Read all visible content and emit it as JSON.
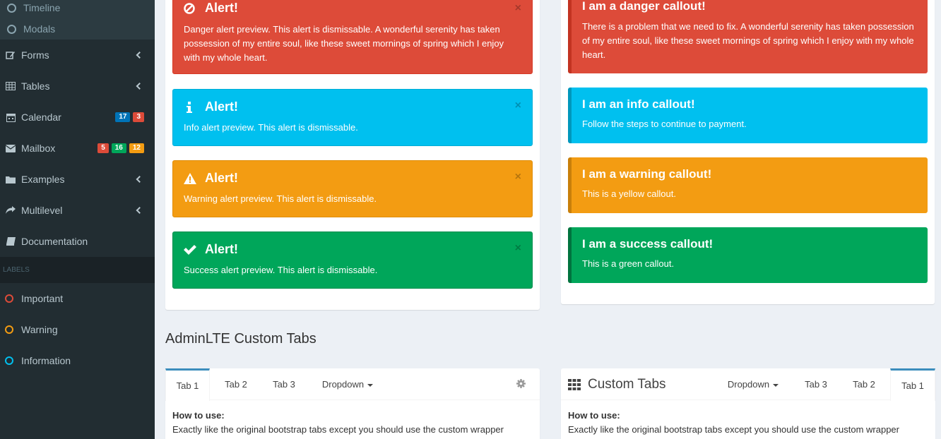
{
  "sidebar": {
    "sub_items": [
      {
        "label": "Timeline"
      },
      {
        "label": "Modals"
      }
    ],
    "items": [
      {
        "label": "Forms",
        "icon": "edit-icon"
      },
      {
        "label": "Tables",
        "icon": "table-icon"
      },
      {
        "label": "Calendar",
        "icon": "calendar-icon",
        "badges": [
          {
            "text": "17",
            "color": "#0073b7"
          },
          {
            "text": "3",
            "color": "#dd4b39"
          }
        ]
      },
      {
        "label": "Mailbox",
        "icon": "envelope-icon",
        "badges": [
          {
            "text": "5",
            "color": "#dd4b39"
          },
          {
            "text": "16",
            "color": "#00a65a"
          },
          {
            "text": "12",
            "color": "#f39c12"
          }
        ]
      },
      {
        "label": "Examples",
        "icon": "folder-icon"
      },
      {
        "label": "Multilevel",
        "icon": "share-icon"
      },
      {
        "label": "Documentation",
        "icon": "book-icon"
      }
    ],
    "labels_header": "LABELS",
    "labels": [
      {
        "label": "Important",
        "color": "#dd4b39"
      },
      {
        "label": "Warning",
        "color": "#f39c12"
      },
      {
        "label": "Information",
        "color": "#00c0ef"
      }
    ]
  },
  "alerts": [
    {
      "title": "Alert!",
      "text": "Danger alert preview. This alert is dismissable. A wonderful serenity has taken possession of my entire soul, like these sweet mornings of spring which I enjoy with my whole heart.",
      "color": "#dd4b39",
      "icon": "ban-icon"
    },
    {
      "title": "Alert!",
      "text": "Info alert preview. This alert is dismissable.",
      "color": "#00c0ef",
      "icon": "info-icon"
    },
    {
      "title": "Alert!",
      "text": "Warning alert preview. This alert is dismissable.",
      "color": "#f39c12",
      "icon": "warning-icon"
    },
    {
      "title": "Alert!",
      "text": "Success alert preview. This alert is dismissable.",
      "color": "#00a65a",
      "icon": "check-icon"
    }
  ],
  "close_glyph": "×",
  "callouts": [
    {
      "title": "I am a danger callout!",
      "text": "There is a problem that we need to fix. A wonderful serenity has taken possession of my entire soul, like these sweet mornings of spring which I enjoy with my whole heart.",
      "color": "#dd4b39",
      "border": "#c23321"
    },
    {
      "title": "I am an info callout!",
      "text": "Follow the steps to continue to payment.",
      "color": "#00c0ef",
      "border": "#0097bc"
    },
    {
      "title": "I am a warning callout!",
      "text": "This is a yellow callout.",
      "color": "#f39c12",
      "border": "#c87f0a"
    },
    {
      "title": "I am a success callout!",
      "text": "This is a green callout.",
      "color": "#00a65a",
      "border": "#00733e"
    }
  ],
  "section_title": "AdminLTE Custom Tabs",
  "tabs_left": {
    "tabs": [
      "Tab 1",
      "Tab 2",
      "Tab 3"
    ],
    "dropdown": "Dropdown",
    "body_heading": "How to use:",
    "body_text": "Exactly like the original bootstrap tabs except you should use the custom wrapper"
  },
  "tabs_right": {
    "header_title": "Custom Tabs",
    "dropdown": "Dropdown",
    "tabs": [
      "Tab 3",
      "Tab 2",
      "Tab 1"
    ],
    "body_heading": "How to use:",
    "body_text": "Exactly like the original bootstrap tabs except you should use the custom wrapper"
  }
}
